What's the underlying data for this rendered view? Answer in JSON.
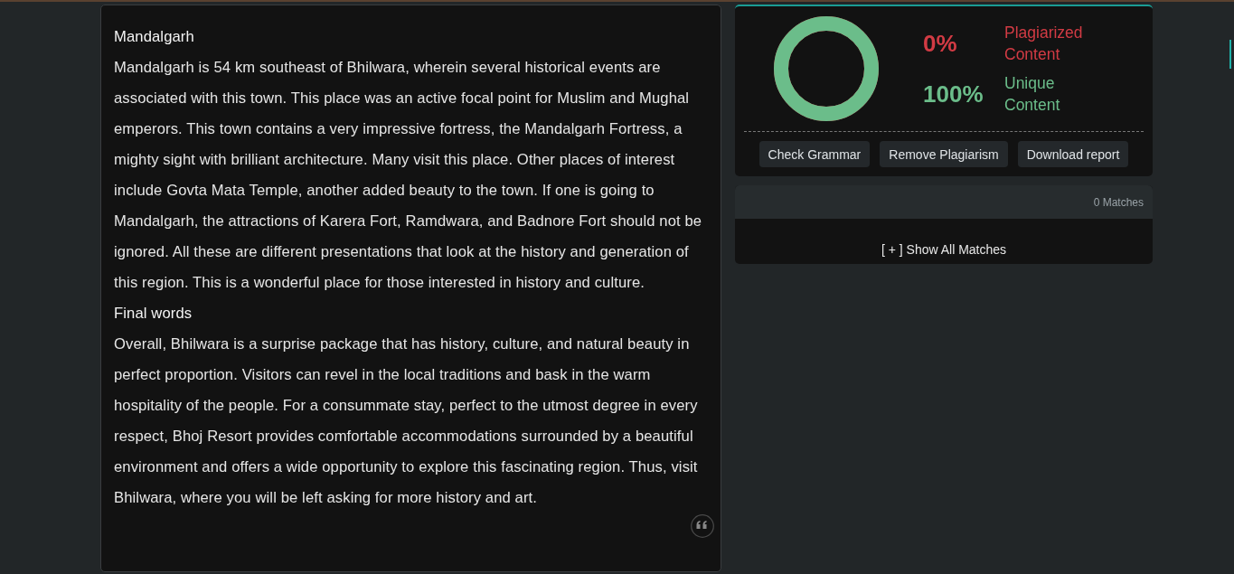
{
  "document": {
    "blocks": [
      {
        "kind": "heading",
        "text": "Mandalgarh"
      },
      {
        "kind": "paragraph",
        "text": "Mandalgarh is 54 km southeast of Bhilwara, wherein several historical events are associated with this town. This place was an active focal point for Muslim and Mughal emperors. This town contains a very impressive fortress, the Mandalgarh Fortress, a mighty sight with brilliant architecture. Many visit this place. Other places of interest include Govta Mata Temple, another added beauty to the town. If one is going to Mandalgarh, the attractions of Karera Fort, Ramdwara, and Badnore Fort should not be ignored. All these are different presentations that look at the history and generation of this region. This is a wonderful place for those interested in history and culture."
      },
      {
        "kind": "heading",
        "text": "Final words"
      },
      {
        "kind": "paragraph",
        "text": "Overall, Bhilwara is a surprise package that has history, culture, and natural beauty in perfect proportion. Visitors can revel in the local traditions and bask in the warm hospitality of the people. For a consummate stay, perfect to the utmost degree in every respect, Bhoj Resort provides comfortable accommodations surrounded by a beautiful environment and offers a wide opportunity to explore this fascinating region. Thus, visit Bhilwara, where you will be left asking for more history and art."
      }
    ]
  },
  "result": {
    "donut": {
      "level": 1
    },
    "stats": [
      {
        "percent": "0%",
        "label": "Plagiarized Content",
        "color": "#d23b44"
      },
      {
        "percent": "100%",
        "label": "Unique Content",
        "color": "#6bbd8a"
      }
    ],
    "buttons": [
      "Check Grammar",
      "Remove Plagiarism",
      "Download report"
    ]
  },
  "matches": {
    "count": "0 Matches",
    "toggle": "[ + ] Show All Matches"
  }
}
